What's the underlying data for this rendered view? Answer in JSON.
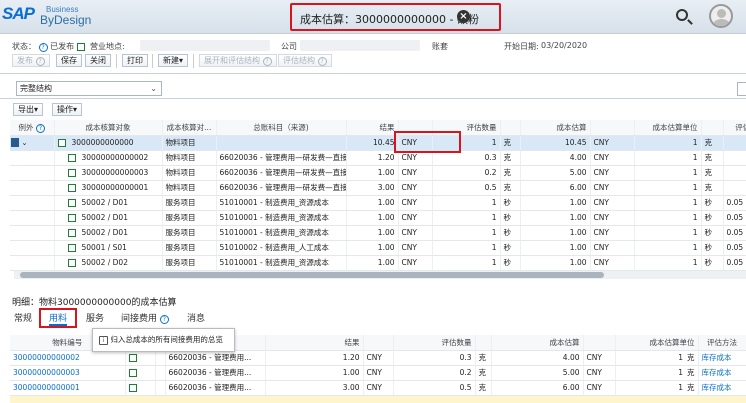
{
  "header": {
    "logo_sap": "SAP",
    "logo_business": "Business",
    "logo_bydesign": "ByDesign",
    "title": "成本估算：3000000000000 - 碳粉",
    "close_icon": "close-icon",
    "search_icon": "search-icon",
    "avatar_icon": "user-avatar-icon"
  },
  "meta": {
    "status_label": "状态：",
    "status_value": "已发布",
    "site_label": "营业地点:",
    "company_label": "公司",
    "ledger_label": "账套",
    "start_label": "开始日期:",
    "start_value": "03/20/2020"
  },
  "toolbar": {
    "publish": "发布",
    "save": "保存",
    "close": "关闭",
    "print": "打印",
    "new": "新建",
    "expand": "展开和评估结构",
    "eval": "评估结构"
  },
  "structure_select": {
    "value": "完整结构"
  },
  "table_toolbar": {
    "export": "导出",
    "actions": "操作"
  },
  "grid": {
    "headers": [
      "例外",
      "成本核算对象",
      "成本核算对...",
      "总账科目（来源)",
      "结果",
      "",
      "评估数量",
      "",
      "成本估算",
      "",
      "成本估算单位",
      "",
      "评估方"
    ],
    "rows": [
      {
        "obj": "3000000000000",
        "type": "物料项目",
        "acct": "",
        "result": "10.45",
        "cur": "CNY",
        "qty": "1",
        "qunit": "克",
        "cost": "10.45",
        "ccur": "CNY",
        "unit": "1",
        "uunit": "克",
        "eval": ""
      },
      {
        "obj": "30000000000002",
        "type": "物料项目",
        "acct": "66020036 - 管理费用—研发费—直接投入",
        "result": "1.20",
        "cur": "CNY",
        "qty": "0.3",
        "qunit": "克",
        "cost": "4.00",
        "ccur": "CNY",
        "unit": "1",
        "uunit": "克",
        "eval": ""
      },
      {
        "obj": "30000000000003",
        "type": "物料项目",
        "acct": "66020036 - 管理费用—研发费—直接投入",
        "result": "1.00",
        "cur": "CNY",
        "qty": "0.2",
        "qunit": "克",
        "cost": "5.00",
        "ccur": "CNY",
        "unit": "1",
        "uunit": "克",
        "eval": ""
      },
      {
        "obj": "30000000000001",
        "type": "物料项目",
        "acct": "66020036 - 管理费用—研发费—直接投入",
        "result": "3.00",
        "cur": "CNY",
        "qty": "0.5",
        "qunit": "克",
        "cost": "6.00",
        "ccur": "CNY",
        "unit": "1",
        "uunit": "克",
        "eval": ""
      },
      {
        "obj": "50002 / D01",
        "type": "服务项目",
        "acct": "51010001 - 制造费用_资源成本",
        "result": "1.00",
        "cur": "CNY",
        "qty": "1",
        "qunit": "秒",
        "cost": "1.00",
        "ccur": "CNY",
        "unit": "1",
        "uunit": "秒",
        "eval": "0.05"
      },
      {
        "obj": "50002 / D01",
        "type": "服务项目",
        "acct": "51010001 - 制造费用_资源成本",
        "result": "1.00",
        "cur": "CNY",
        "qty": "1",
        "qunit": "秒",
        "cost": "1.00",
        "ccur": "CNY",
        "unit": "1",
        "uunit": "秒",
        "eval": "0.05"
      },
      {
        "obj": "50002 / D01",
        "type": "服务项目",
        "acct": "51010001 - 制造费用_资源成本",
        "result": "1.00",
        "cur": "CNY",
        "qty": "1",
        "qunit": "秒",
        "cost": "1.00",
        "ccur": "CNY",
        "unit": "1",
        "uunit": "秒",
        "eval": "0.05"
      },
      {
        "obj": "50001 / S01",
        "type": "服务项目",
        "acct": "51010002 - 制造费用_人工成本",
        "result": "1.00",
        "cur": "CNY",
        "qty": "1",
        "qunit": "秒",
        "cost": "1.00",
        "ccur": "CNY",
        "unit": "1",
        "uunit": "秒",
        "eval": "0.05"
      },
      {
        "obj": "50002 / D02",
        "type": "服务项目",
        "acct": "51010001 - 制造费用_资源成本",
        "result": "1.00",
        "cur": "CNY",
        "qty": "1",
        "qunit": "秒",
        "cost": "1.00",
        "ccur": "CNY",
        "unit": "1",
        "uunit": "秒",
        "eval": "0.05"
      }
    ]
  },
  "detail": {
    "title": "明细：物料3000000000000的成本估算",
    "tabs": [
      "常规",
      "用料",
      "服务",
      "间接费用",
      "消息"
    ],
    "tooltip": "归入总成本的所有间接费用的总览",
    "headers": [
      "物料编号",
      "",
      "",
      "",
      "结果",
      "",
      "评估数量",
      "",
      "成本估算",
      "",
      "成本估算单位",
      "评估方法"
    ],
    "rows": [
      {
        "id": "30000000000002",
        "acct": "66020036 - 管理费用...",
        "result": "1.20",
        "cur": "CNY",
        "qty": "0.3",
        "qunit": "克",
        "cost": "4.00",
        "ccur": "CNY",
        "unit": "1",
        "uunit": "克",
        "method": "库存成本"
      },
      {
        "id": "30000000000003",
        "acct": "66020036 - 管理费用...",
        "result": "1.00",
        "cur": "CNY",
        "qty": "0.2",
        "qunit": "克",
        "cost": "5.00",
        "ccur": "CNY",
        "unit": "1",
        "uunit": "克",
        "method": "库存成本"
      },
      {
        "id": "30000000000001",
        "acct": "66020036 - 管理费用...",
        "result": "3.00",
        "cur": "CNY",
        "qty": "0.5",
        "qunit": "克",
        "cost": "6.00",
        "ccur": "CNY",
        "unit": "1",
        "uunit": "克",
        "method": "库存成本"
      }
    ]
  },
  "colors": {
    "accent": "#0a6ed1",
    "highlight": "#d9141f",
    "ok": "#1c7f36"
  }
}
